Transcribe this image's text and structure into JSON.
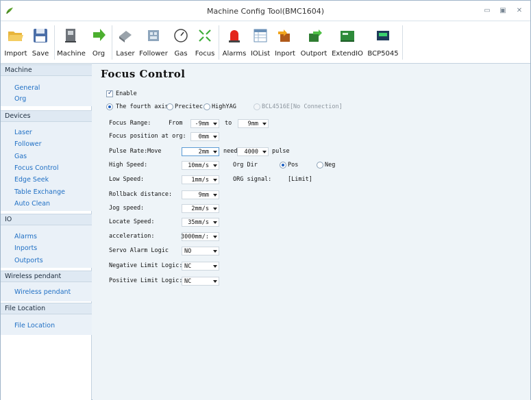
{
  "window": {
    "title": "Machine Config Tool(BMC1604)"
  },
  "toolbar": {
    "buttons": [
      {
        "label": "Import",
        "icon": "folder-open-icon"
      },
      {
        "label": "Save",
        "icon": "floppy-disk-icon"
      },
      {
        "label": "Machine",
        "icon": "machine-icon"
      },
      {
        "label": "Org",
        "icon": "arrow-right-icon"
      },
      {
        "label": "Laser",
        "icon": "laser-head-icon"
      },
      {
        "label": "Follower",
        "icon": "follower-icon"
      },
      {
        "label": "Gas",
        "icon": "gauge-icon"
      },
      {
        "label": "Focus",
        "icon": "focus-icon"
      },
      {
        "label": "Alarms",
        "icon": "siren-icon"
      },
      {
        "label": "IOList",
        "icon": "table-icon"
      },
      {
        "label": "Inport",
        "icon": "inport-icon"
      },
      {
        "label": "Outport",
        "icon": "outport-icon"
      },
      {
        "label": "ExtendIO",
        "icon": "board-icon"
      },
      {
        "label": "BCP5045",
        "icon": "chip-icon"
      }
    ]
  },
  "sidebar": {
    "sections": [
      {
        "header": "Machine",
        "items": [
          "General",
          "Org"
        ]
      },
      {
        "header": "Devices",
        "items": [
          "Laser",
          "Follower",
          "Gas",
          "Focus Control",
          "Edge Seek",
          "Table Exchange",
          "Auto Clean"
        ]
      },
      {
        "header": "IO",
        "items": [
          "Alarms",
          "Inports",
          "Outports"
        ]
      },
      {
        "header": "Wireless pendant",
        "items": [
          "Wireless pendant"
        ]
      },
      {
        "header": "File Location",
        "items": [
          "File Location"
        ]
      }
    ]
  },
  "main": {
    "heading": "Focus Control",
    "enable": {
      "label": "Enable",
      "checked": true
    },
    "axis_options": {
      "fourth_axis": "The fourth axis",
      "precitec": "Precitec",
      "highyag": "HighYAG",
      "bcl": "BCL4516E[No Connection]",
      "selected": "The fourth axis"
    },
    "focus_range": {
      "label": "Focus Range:",
      "from_label": "From",
      "from_value": "-9mm",
      "to_label": "to",
      "to_value": "9mm"
    },
    "focus_position": {
      "label": "Focus position at org:",
      "value": "0mm"
    },
    "pulse_rate": {
      "label": "Pulse Rate:",
      "move_label": "Move",
      "move_value": "2mm",
      "need_label": "need",
      "need_value": "4000",
      "pulse_label": "pulse"
    },
    "high_speed": {
      "label": "High Speed:",
      "value": "10mm/s"
    },
    "org_dir": {
      "label": "Org Dir",
      "pos": "Pos",
      "neg": "Neg",
      "selected": "Pos"
    },
    "low_speed": {
      "label": "Low Speed:",
      "value": "1mm/s"
    },
    "org_signal": {
      "label": "ORG signal:",
      "value": "[Limit]"
    },
    "rollback": {
      "label": "Rollback distance:",
      "value": "9mm"
    },
    "jog_speed": {
      "label": "Jog speed:",
      "value": "2mm/s"
    },
    "locate_speed": {
      "label": "Locate Speed:",
      "value": "35mm/s"
    },
    "acceleration": {
      "label": "acceleration:",
      "value": "3000mm/:"
    },
    "servo_alarm": {
      "label": "Servo Alarm Logic",
      "value": "NO"
    },
    "neg_limit": {
      "label": "Negative Limit Logic:",
      "value": "NC"
    },
    "pos_limit": {
      "label": "Positive Limit Logic:",
      "value": "NC"
    }
  }
}
